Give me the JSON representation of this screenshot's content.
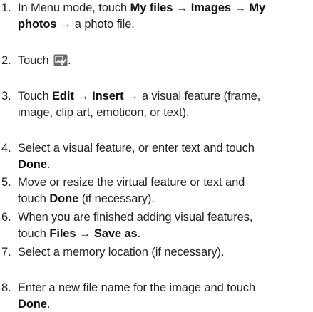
{
  "steps": [
    {
      "num": "1.",
      "lines": [
        [
          {
            "t": "In Menu mode, touch "
          },
          {
            "t": "My files",
            "b": true
          },
          {
            "t": " → "
          },
          {
            "t": "Images",
            "b": true
          },
          {
            "t": " → "
          },
          {
            "t": "My",
            "b": true
          }
        ],
        [
          {
            "t": "photos",
            "b": true
          },
          {
            "t": " → a photo file."
          }
        ]
      ]
    },
    {
      "num": "2.",
      "lines": [
        [
          {
            "t": "Touch "
          },
          {
            "icon": "photo-edit-icon"
          },
          {
            "t": "."
          }
        ]
      ]
    },
    {
      "num": "3.",
      "lines": [
        [
          {
            "t": "Touch "
          },
          {
            "t": "Edit",
            "b": true
          },
          {
            "t": " → "
          },
          {
            "t": "Insert",
            "b": true
          },
          {
            "t": " → a visual feature (frame,"
          }
        ],
        [
          {
            "t": "image, clip art, emoticon, or text)."
          }
        ]
      ]
    },
    {
      "num": "4.",
      "lines": [
        [
          {
            "t": "Select a visual feature, or enter text and touch"
          }
        ],
        [
          {
            "t": "Done",
            "b": true
          },
          {
            "t": "."
          }
        ]
      ]
    },
    {
      "num": "5.",
      "lines": [
        [
          {
            "t": "Move or resize the virtual feature or text and"
          }
        ],
        [
          {
            "t": "touch "
          },
          {
            "t": "Done",
            "b": true
          },
          {
            "t": " (if necessary)."
          }
        ]
      ]
    },
    {
      "num": "6.",
      "lines": [
        [
          {
            "t": "When you are finished adding visual features,"
          }
        ],
        [
          {
            "t": "touch "
          },
          {
            "t": "Files",
            "b": true
          },
          {
            "t": " → "
          },
          {
            "t": "Save as",
            "b": true
          },
          {
            "t": "."
          }
        ]
      ]
    },
    {
      "num": "7.",
      "lines": [
        [
          {
            "t": "Select a memory location (if necessary)."
          }
        ]
      ]
    },
    {
      "num": "8.",
      "lines": [
        [
          {
            "t": "Enter a new file name for the image and touch"
          }
        ],
        [
          {
            "t": "Done",
            "b": true
          },
          {
            "t": "."
          }
        ]
      ]
    }
  ],
  "colors": {
    "text": "#222222",
    "bold": "#111111",
    "icon_background": "#6b6b6b",
    "icon_foreground": "#ffffff"
  }
}
